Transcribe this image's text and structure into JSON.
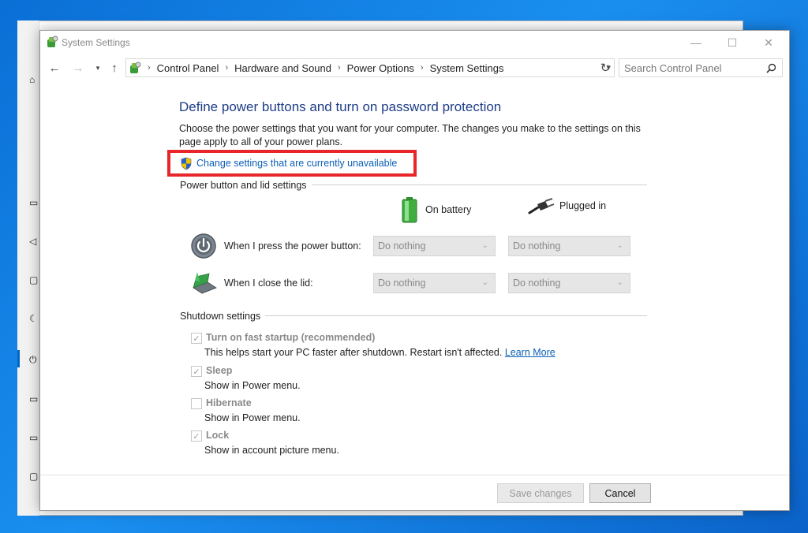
{
  "window": {
    "title": "System Settings",
    "minimize_glyph": "—",
    "maximize_glyph": "☐",
    "close_glyph": "✕"
  },
  "navigation": {
    "breadcrumb": [
      "Control Panel",
      "Hardware and Sound",
      "Power Options",
      "System Settings"
    ],
    "search_placeholder": "Search Control Panel"
  },
  "page": {
    "heading": "Define power buttons and turn on password protection",
    "description": "Choose the power settings that you want for your computer. The changes you make to the settings on this page apply to all of your power plans.",
    "change_link": "Change settings that are currently unavailable"
  },
  "power_section": {
    "title": "Power button and lid settings",
    "col_battery": "On battery",
    "col_plugged": "Plugged in",
    "rows": [
      {
        "label": "When I press the power button:",
        "battery": "Do nothing",
        "plugged": "Do nothing"
      },
      {
        "label": "When I close the lid:",
        "battery": "Do nothing",
        "plugged": "Do nothing"
      }
    ]
  },
  "shutdown_section": {
    "title": "Shutdown settings",
    "items": [
      {
        "label": "Turn on fast startup (recommended)",
        "checked": true,
        "desc": "This helps start your PC faster after shutdown. Restart isn't affected.",
        "link": "Learn More"
      },
      {
        "label": "Sleep",
        "checked": true,
        "desc": "Show in Power menu."
      },
      {
        "label": "Hibernate",
        "checked": false,
        "desc": "Show in Power menu."
      },
      {
        "label": "Lock",
        "checked": true,
        "desc": "Show in account picture menu."
      }
    ]
  },
  "buttons": {
    "save": "Save changes",
    "cancel": "Cancel"
  },
  "colors": {
    "heading": "#1e3d87",
    "link": "#0b5fb6",
    "highlight": "#e8262a",
    "desktop": "#1a8ff0"
  }
}
